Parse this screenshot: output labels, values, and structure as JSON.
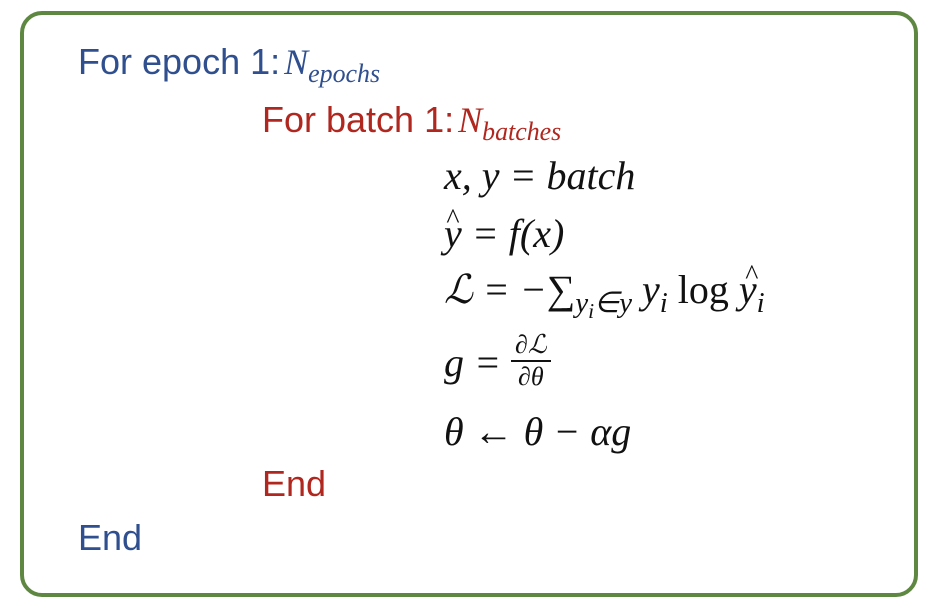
{
  "outer_loop": {
    "label": "For epoch 1:",
    "limit_symbol": "N",
    "limit_subscript": "epochs",
    "end_label": "End"
  },
  "inner_loop": {
    "label": "For batch 1:",
    "limit_symbol": "N",
    "limit_subscript": "batches",
    "end_label": "End"
  },
  "steps": {
    "assign_batch": "x,  y = batch",
    "prediction_hat": "^",
    "prediction_y": "y",
    "prediction_rest": " = f(x)",
    "loss_lhs": "ℒ = −",
    "loss_sum": "∑",
    "loss_sum_sub_y": "y",
    "loss_sum_sub_i": "i",
    "loss_sum_sub_rest": "∈y",
    "loss_term_y": "y",
    "loss_term_i": "i",
    "loss_log": "log",
    "loss_hat": "^",
    "loss_yhat": "y",
    "loss_yhat_i": "i",
    "gradient_lhs": "g = ",
    "gradient_num": "∂ℒ",
    "gradient_den": "∂θ",
    "update": "θ ← θ  −  αg"
  },
  "colors": {
    "border": "#5e8741",
    "outer_loop": "#2f4f8f",
    "inner_loop": "#b0271f",
    "math": "#111111"
  }
}
